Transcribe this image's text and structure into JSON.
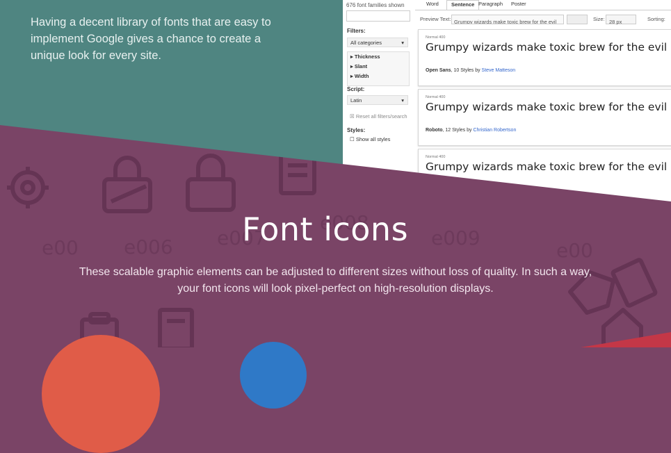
{
  "intro": {
    "text": "Having a decent library of fonts that are easy to implement Google gives a chance to create a unique look for every site."
  },
  "screenshot": {
    "count": "676 font families shown",
    "filters_label": "Filters:",
    "category": "All categories",
    "accordion": [
      "▸ Thickness",
      "▸ Slant",
      "▸ Width"
    ],
    "script_label": "Script:",
    "script": "Latin",
    "reset": "Reset all filters/search",
    "styles_label": "Styles:",
    "show_all": "Show all styles",
    "tabs": [
      "Word",
      "Sentence",
      "Paragraph",
      "Poster"
    ],
    "active_tab": "Sentence",
    "preview_label": "Preview Text:",
    "preview_text": "Grumpy wizards make toxic brew for the evil",
    "size_label": "Size:",
    "size_value": "28 px",
    "sorting_label": "Sorting:",
    "cards": [
      {
        "weight": "Normal 400",
        "sample": "Grumpy wizards make toxic brew for the evil Queen and Jack.",
        "font": "Open Sans",
        "styles": ", 10 Styles by ",
        "author": "Steve Matteson"
      },
      {
        "weight": "Normal 400",
        "sample": "Grumpy wizards make toxic brew for the evil Queen and Jack.",
        "font": "Roboto",
        "styles": ", 12 Styles by ",
        "author": "Christian Robertson"
      },
      {
        "weight": "Normal 400",
        "sample": "Grumpy wizards make toxic brew for the evil Queen and Jack.",
        "font": "",
        "styles": "",
        "author": ""
      }
    ]
  },
  "section": {
    "title": "Font icons",
    "description": "These scalable graphic elements can be adjusted to different sizes without loss of quality. In such a way, your font icons will look pixel-perfect on high-resolution displays."
  },
  "colors": {
    "teal": "#4f8581",
    "purple": "#7a4466",
    "red": "#e05c48",
    "blue": "#2f79c7"
  },
  "icons": [
    "gear-icon",
    "padlock-icon",
    "unlocked-padlock-icon",
    "document-icon",
    "bookmark-icon",
    "clipboard-icon",
    "tag-icon"
  ]
}
